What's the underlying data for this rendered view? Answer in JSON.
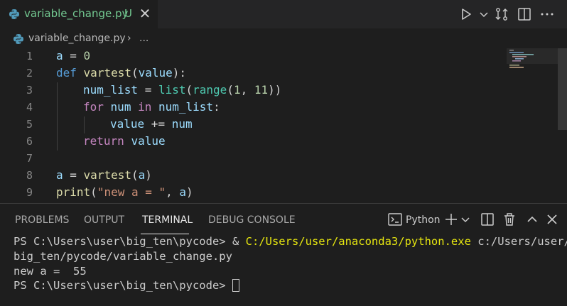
{
  "tab": {
    "title": "variable_change.py",
    "status": "U",
    "close_glyph": "✕",
    "color": "#73c991"
  },
  "breadcrumb": {
    "file": "variable_change.py",
    "separator": "›",
    "more": "..."
  },
  "editor": {
    "lines": [
      {
        "number": "1"
      },
      {
        "number": "2"
      },
      {
        "number": "3"
      },
      {
        "number": "4"
      },
      {
        "number": "5"
      },
      {
        "number": "6"
      },
      {
        "number": "7"
      },
      {
        "number": "8"
      },
      {
        "number": "9"
      }
    ],
    "tokens": {
      "l1": [
        "a",
        " = ",
        "0"
      ],
      "l2": [
        "def",
        " ",
        "vartest",
        "(",
        "value",
        "):"
      ],
      "l3": [
        "num_list",
        " = ",
        "list",
        "(",
        "range",
        "(",
        "1",
        ", ",
        "11",
        "))"
      ],
      "l4": [
        "for",
        " ",
        "num",
        " ",
        "in",
        " ",
        "num_list",
        ":"
      ],
      "l5": [
        "value",
        " += ",
        "num"
      ],
      "l6": [
        "return",
        " ",
        "value"
      ],
      "l8": [
        "a",
        " = ",
        "vartest",
        "(",
        "a",
        ")"
      ],
      "l9": [
        "print",
        "(",
        "\"new a = \"",
        ", ",
        "a",
        ")"
      ]
    }
  },
  "panel": {
    "tabs": [
      "PROBLEMS",
      "OUTPUT",
      "TERMINAL",
      "DEBUG CONSOLE"
    ],
    "active_tab": "TERMINAL",
    "shell_name": "Python",
    "terminal": {
      "line1_prompt": "PS C:\\Users\\user\\big_ten\\pycode> & ",
      "line1_exe": "C:/Users/user/anaconda3/python.exe",
      "line1_arg": " c:/Users/user/",
      "line2": "big_ten/pycode/variable_change.py",
      "line3": "new a =  55",
      "line4_prompt": "PS C:\\Users\\user\\big_ten\\pycode> "
    }
  },
  "colors": {
    "background": "#1e1e1e",
    "tabbar": "#252526",
    "keyword": "#569cd6",
    "control": "#c586c0",
    "function": "#dcdcaa",
    "variable": "#9cdcfe",
    "number": "#b5cea8",
    "string": "#ce9178",
    "builtin": "#4ec9b0",
    "exe_path": "#e5e510"
  },
  "icons": {
    "python_file": "python-icon",
    "run": "play-icon",
    "compare": "compare-changes-icon",
    "split": "split-editor-icon",
    "more": "more-actions-icon",
    "terminal": "terminal-icon",
    "new_terminal": "plus-icon",
    "dropdown": "chevron-down-icon",
    "split_terminal": "split-panel-icon",
    "trash": "trash-icon",
    "maximize": "chevron-up-icon",
    "close": "close-icon"
  }
}
